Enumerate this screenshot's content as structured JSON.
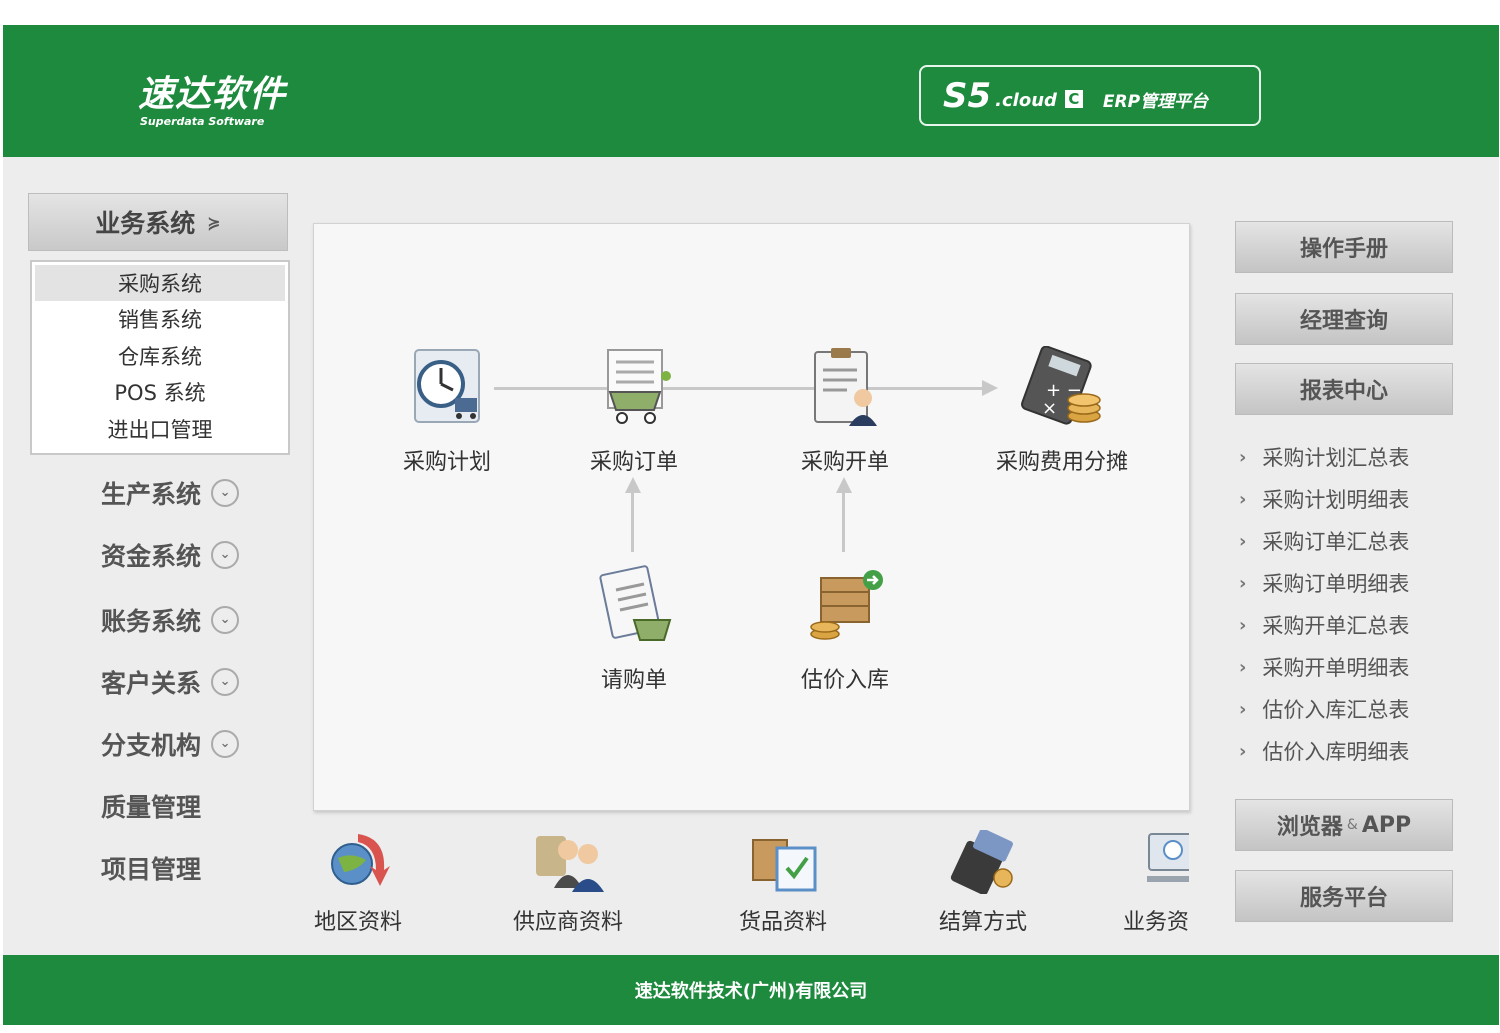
{
  "header": {
    "logo_main": "速达软件",
    "logo_sub": "Superdata Software",
    "badge_s5": "S5",
    "badge_cloud": ".cloud",
    "badge_c": "C",
    "badge_erp": "ERP管理平台",
    "color": "#1e8a3e"
  },
  "sidebar": {
    "business": {
      "label": "业务系统",
      "icon": "double-chevron-down-icon"
    },
    "sub_items": [
      "采购系统",
      "销售系统",
      "仓库系统",
      "POS 系统",
      "进出口管理"
    ],
    "items": [
      {
        "label": "生产系统",
        "expandable": true
      },
      {
        "label": "资金系统",
        "expandable": true
      },
      {
        "label": "账务系统",
        "expandable": true
      },
      {
        "label": "客户关系",
        "expandable": true
      },
      {
        "label": "分支机构",
        "expandable": true
      },
      {
        "label": "质量管理",
        "expandable": false
      },
      {
        "label": "项目管理",
        "expandable": false
      }
    ]
  },
  "flow": {
    "nodes": [
      {
        "label": "采购计划",
        "icon": "clock-cart-icon"
      },
      {
        "label": "采购订单",
        "icon": "order-cart-icon"
      },
      {
        "label": "采购开单",
        "icon": "clipboard-person-icon"
      },
      {
        "label": "采购费用分摊",
        "icon": "calculator-coins-icon"
      },
      {
        "label": "请购单",
        "icon": "requisition-basket-icon"
      },
      {
        "label": "估价入库",
        "icon": "boxes-coins-icon"
      }
    ]
  },
  "quick_links": [
    {
      "label": "地区资料",
      "icon": "globe-arrow-icon"
    },
    {
      "label": "供应商资料",
      "icon": "supplier-people-icon"
    },
    {
      "label": "货品资料",
      "icon": "goods-box-icon"
    },
    {
      "label": "结算方式",
      "icon": "card-terminal-icon"
    },
    {
      "label": "业务资",
      "icon": "computer-icon"
    }
  ],
  "right": {
    "manual": "操作手册",
    "manager_query": "经理查询",
    "report_center": "报表中心",
    "reports": [
      "采购计划汇总表",
      "采购计划明细表",
      "采购订单汇总表",
      "采购订单明细表",
      "采购开单汇总表",
      "采购开单明细表",
      "估价入库汇总表",
      "估价入库明细表"
    ],
    "browser_a": "浏览器",
    "browser_amp": "&",
    "browser_b": "APP",
    "service": "服务平台"
  },
  "footer": {
    "company": "速达软件技术(广州)有限公司"
  }
}
